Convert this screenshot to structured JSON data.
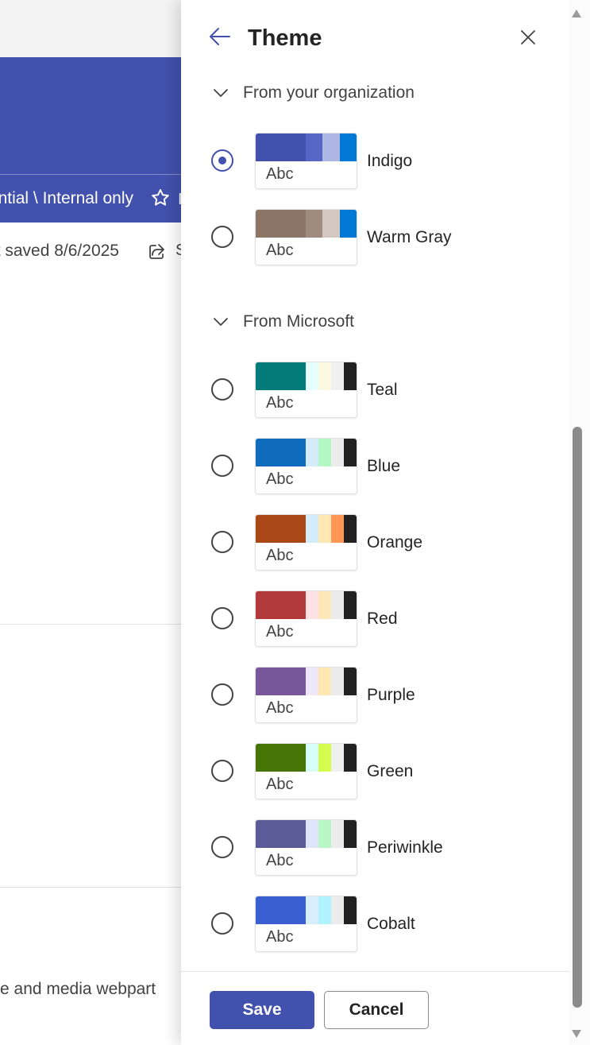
{
  "background": {
    "banner_label": "ntial \\ Internal only",
    "saved_text": "t saved 8/6/2025",
    "share_tail": "S",
    "star_tail": "I",
    "footer_text": "e and media webpart",
    "colors": {
      "banner": "#4251ad",
      "topbar": "#f3f3f3"
    }
  },
  "panel": {
    "title": "Theme",
    "back_icon": "arrow-left-icon",
    "close_icon": "close-icon",
    "sections": [
      {
        "label": "From your organization",
        "themes": [
          {
            "name": "Indigo",
            "selected": true,
            "sample": "Abc",
            "colors": [
              "#4251ad",
              "#5566c4",
              "#aeb6e3",
              "#0078d4"
            ]
          },
          {
            "name": "Warm Gray",
            "selected": false,
            "sample": "Abc",
            "colors": [
              "#8a7567",
              "#a08c7e",
              "#d4c8c2",
              "#0078d4"
            ]
          }
        ]
      },
      {
        "label": "From Microsoft",
        "themes": [
          {
            "name": "Teal",
            "selected": false,
            "sample": "Abc",
            "colors": [
              "#037c7b",
              "#e5fdfd",
              "#fdf8e1",
              "#f0f0f0",
              "#212121"
            ]
          },
          {
            "name": "Blue",
            "selected": false,
            "sample": "Abc",
            "colors": [
              "#0f6cbd",
              "#d6ecfb",
              "#b3f8c2",
              "#ececec",
              "#212121"
            ]
          },
          {
            "name": "Orange",
            "selected": false,
            "sample": "Abc",
            "colors": [
              "#a94716",
              "#d3ecfb",
              "#fde8b4",
              "#ff9653",
              "#212121"
            ]
          },
          {
            "name": "Red",
            "selected": false,
            "sample": "Abc",
            "colors": [
              "#b33a3a",
              "#fde1e3",
              "#fde7b9",
              "#ececec",
              "#212121"
            ]
          },
          {
            "name": "Purple",
            "selected": false,
            "sample": "Abc",
            "colors": [
              "#77569a",
              "#efe8fb",
              "#fde8b4",
              "#ececec",
              "#212121"
            ]
          },
          {
            "name": "Green",
            "selected": false,
            "sample": "Abc",
            "colors": [
              "#467405",
              "#d6fdf8",
              "#d4fb4d",
              "#f0f0f0",
              "#212121"
            ]
          },
          {
            "name": "Periwinkle",
            "selected": false,
            "sample": "Abc",
            "colors": [
              "#5b5b98",
              "#dfe6fc",
              "#b9f6c6",
              "#ececec",
              "#212121"
            ]
          },
          {
            "name": "Cobalt",
            "selected": false,
            "sample": "Abc",
            "colors": [
              "#3a5fd1",
              "#d8eefc",
              "#aef3fd",
              "#ececec",
              "#212121"
            ]
          }
        ]
      }
    ],
    "save_label": "Save",
    "cancel_label": "Cancel",
    "accent_color": "#4251ad"
  }
}
